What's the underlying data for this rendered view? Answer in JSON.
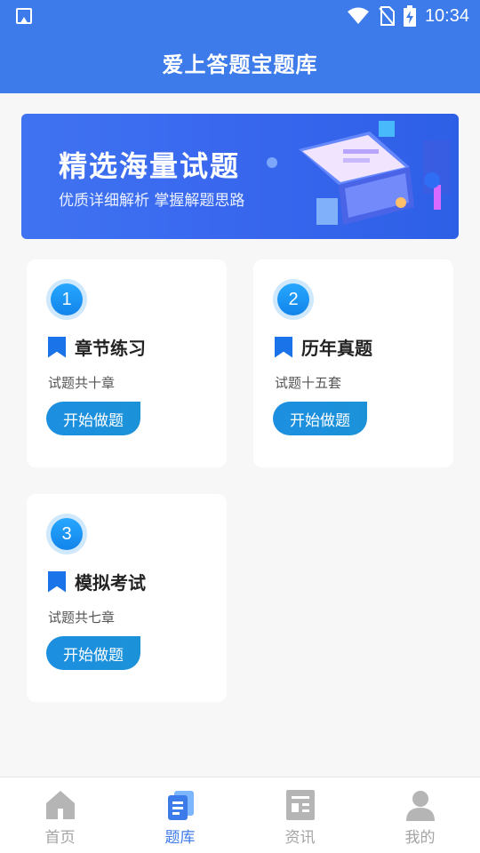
{
  "status": {
    "time": "10:34"
  },
  "header": {
    "title": "爱上答题宝题库"
  },
  "banner": {
    "title": "精选海量试题",
    "subtitle": "优质详细解析 掌握解题思路"
  },
  "cards": [
    {
      "number": "1",
      "title": "章节练习",
      "desc": "试题共十章",
      "button": "开始做题"
    },
    {
      "number": "2",
      "title": "历年真题",
      "desc": "试题十五套",
      "button": "开始做题"
    },
    {
      "number": "3",
      "title": "模拟考试",
      "desc": "试题共七章",
      "button": "开始做题"
    }
  ],
  "tabs": [
    {
      "label": "首页",
      "icon": "home-icon",
      "active": false
    },
    {
      "label": "题库",
      "icon": "question-bank-icon",
      "active": true
    },
    {
      "label": "资讯",
      "icon": "news-icon",
      "active": false
    },
    {
      "label": "我的",
      "icon": "profile-icon",
      "active": false
    }
  ],
  "colors": {
    "primary": "#3d7bea",
    "button": "#1d8fe0",
    "inactive": "#a4a4a4"
  }
}
